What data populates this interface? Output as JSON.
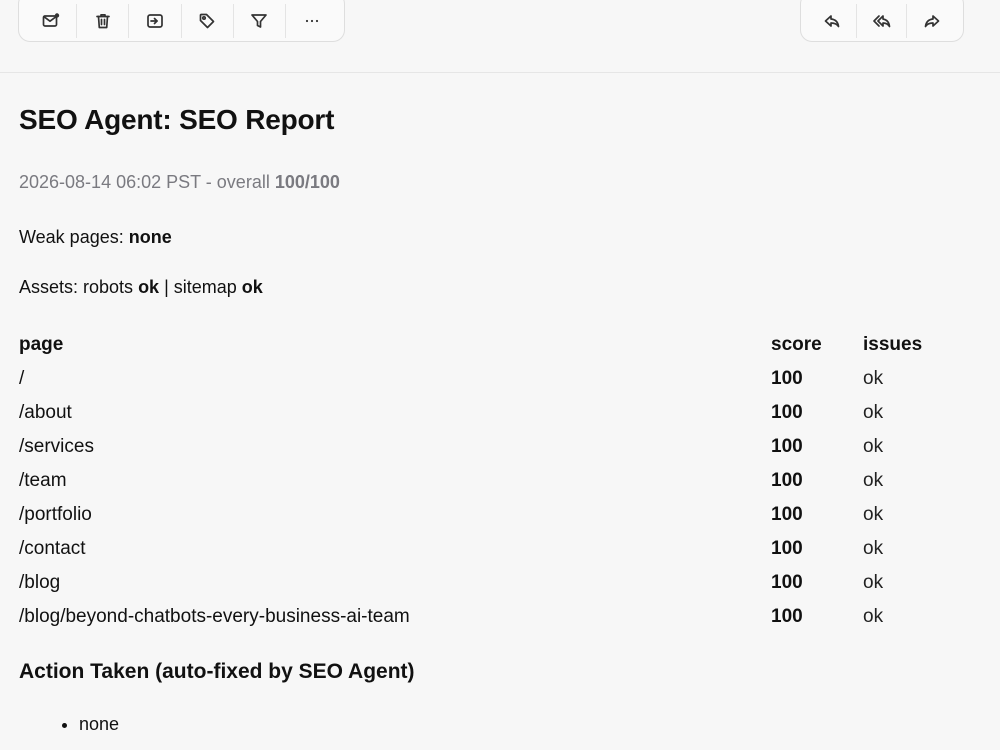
{
  "toolbar": {
    "left_icons": [
      "mark-unread-icon",
      "trash-icon",
      "move-icon",
      "tag-icon",
      "filter-icon",
      "more-icon"
    ],
    "right_icons": [
      "reply-icon",
      "reply-all-icon",
      "forward-icon"
    ]
  },
  "email": {
    "title": "SEO Agent: SEO Report",
    "meta_prefix": "2026-08-14 06:02 PST - overall ",
    "meta_score": "100/100",
    "weak_label": "Weak pages: ",
    "weak_value": "none",
    "assets_label": "Assets: robots ",
    "robots_value": "ok",
    "assets_sep": " | sitemap ",
    "sitemap_value": "ok",
    "table": {
      "headers": [
        "page",
        "score",
        "issues"
      ],
      "rows": [
        {
          "page": "/",
          "score": "100",
          "issues": "ok"
        },
        {
          "page": "/about",
          "score": "100",
          "issues": "ok"
        },
        {
          "page": "/services",
          "score": "100",
          "issues": "ok"
        },
        {
          "page": "/team",
          "score": "100",
          "issues": "ok"
        },
        {
          "page": "/portfolio",
          "score": "100",
          "issues": "ok"
        },
        {
          "page": "/contact",
          "score": "100",
          "issues": "ok"
        },
        {
          "page": "/blog",
          "score": "100",
          "issues": "ok"
        },
        {
          "page": "/blog/beyond-chatbots-every-business-ai-team",
          "score": "100",
          "issues": "ok"
        }
      ]
    },
    "action_heading": "Action Taken (auto-fixed by SEO Agent)",
    "actions": [
      "none"
    ]
  }
}
